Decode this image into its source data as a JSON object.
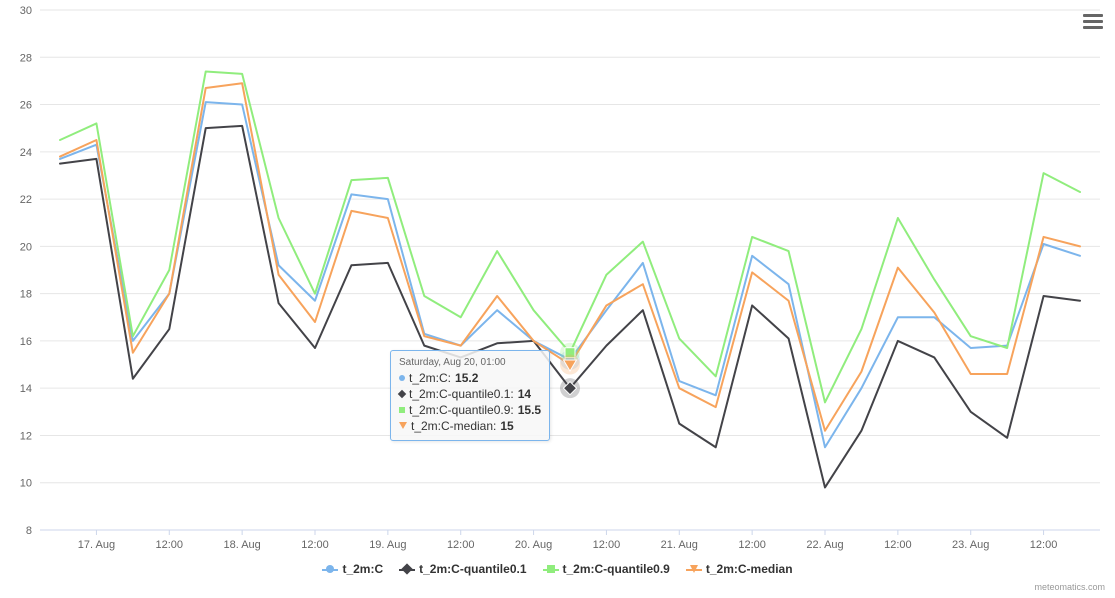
{
  "chart_data": {
    "type": "line",
    "ylabel": "",
    "xlabel": "",
    "ylim": [
      8,
      30
    ],
    "y_ticks": [
      8,
      10,
      12,
      14,
      16,
      18,
      20,
      22,
      24,
      26,
      28,
      30
    ],
    "x_tick_labels": [
      "17. Aug",
      "12:00",
      "18. Aug",
      "12:00",
      "19. Aug",
      "12:00",
      "20. Aug",
      "12:00",
      "21. Aug",
      "12:00",
      "22. Aug",
      "12:00",
      "23. Aug",
      "12:00"
    ],
    "x_indices": [
      0,
      1,
      2,
      3,
      4,
      5,
      6,
      7,
      8,
      9,
      10,
      11,
      12,
      13,
      14,
      15,
      16,
      17,
      18,
      19,
      20,
      21,
      22,
      23,
      24,
      25,
      26,
      27,
      28
    ],
    "series": [
      {
        "name": "t_2m:C",
        "color": "#7cb5ec",
        "marker": "circle",
        "values": [
          23.7,
          24.3,
          16.0,
          18.0,
          26.1,
          26.0,
          19.2,
          17.7,
          22.2,
          22.0,
          16.3,
          15.8,
          17.3,
          16.0,
          15.2,
          17.3,
          19.3,
          14.3,
          13.7,
          19.6,
          18.4,
          11.5,
          14.0,
          17.0,
          17.0,
          15.7,
          15.8,
          20.1,
          19.6
        ]
      },
      {
        "name": "t_2m:C-quantile0.1",
        "color": "#434348",
        "marker": "diamond",
        "values": [
          23.5,
          23.7,
          14.4,
          16.5,
          25.0,
          25.1,
          17.6,
          15.7,
          19.2,
          19.3,
          15.8,
          15.3,
          15.9,
          16.0,
          14.0,
          15.8,
          17.3,
          12.5,
          11.5,
          17.5,
          16.1,
          9.8,
          12.2,
          16.0,
          15.3,
          13.0,
          11.9,
          17.9,
          17.7
        ]
      },
      {
        "name": "t_2m:C-quantile0.9",
        "color": "#90ed7d",
        "marker": "square",
        "values": [
          24.5,
          25.2,
          16.2,
          19.0,
          27.4,
          27.3,
          21.2,
          18.0,
          22.8,
          22.9,
          17.9,
          17.0,
          19.8,
          17.3,
          15.5,
          18.8,
          20.2,
          16.1,
          14.5,
          20.4,
          19.8,
          13.4,
          16.5,
          21.2,
          18.6,
          16.2,
          15.7,
          23.1,
          22.3
        ]
      },
      {
        "name": "t_2m:C-median",
        "color": "#f7a35c",
        "marker": "triangle-down",
        "values": [
          23.8,
          24.5,
          15.5,
          18.0,
          26.7,
          26.9,
          18.8,
          16.8,
          21.5,
          21.2,
          16.2,
          15.8,
          17.9,
          16.0,
          15.0,
          17.5,
          18.4,
          14.0,
          13.2,
          18.9,
          17.7,
          12.2,
          14.7,
          19.1,
          17.2,
          14.6,
          14.6,
          20.4,
          20.0
        ]
      }
    ],
    "tooltip": {
      "header": "Saturday, Aug 20, 01:00",
      "point_index": 14,
      "rows": [
        {
          "series": "t_2m:C",
          "value": "15.2",
          "color": "#7cb5ec",
          "marker": "circle"
        },
        {
          "series": "t_2m:C-quantile0.1",
          "value": "14",
          "color": "#434348",
          "marker": "diamond"
        },
        {
          "series": "t_2m:C-quantile0.9",
          "value": "15.5",
          "color": "#90ed7d",
          "marker": "square"
        },
        {
          "series": "t_2m:C-median",
          "value": "15",
          "color": "#f7a35c",
          "marker": "triangle-down"
        }
      ]
    }
  },
  "legend": {
    "items": [
      {
        "label": "t_2m:C",
        "color": "#7cb5ec",
        "marker": "circle"
      },
      {
        "label": "t_2m:C-quantile0.1",
        "color": "#434348",
        "marker": "diamond"
      },
      {
        "label": "t_2m:C-quantile0.9",
        "color": "#90ed7d",
        "marker": "square"
      },
      {
        "label": "t_2m:C-median",
        "color": "#f7a35c",
        "marker": "triangle-down"
      }
    ]
  },
  "credit": "meteomatics.com"
}
